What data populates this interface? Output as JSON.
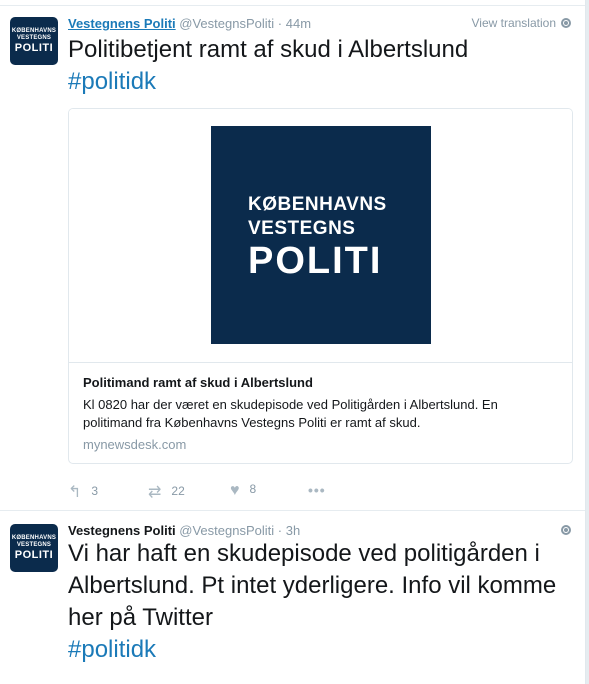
{
  "tweets": [
    {
      "avatar": {
        "line1": "KØBENHAVNS",
        "line2": "VESTEGNS",
        "line3": "POLITI"
      },
      "name": "Vestegnens Politi",
      "handle": "@VestegnsPoliti",
      "separator": "·",
      "time": "44m",
      "translate_label": "View translation",
      "text": "Politibetjent ramt af skud i Albertslund",
      "hashtag": "#politidk",
      "card": {
        "logo": {
          "line1": "KØBENHAVNS",
          "line2": "VESTEGNS",
          "line3": "POLITI"
        },
        "title": "Politimand ramt af skud i Albertslund",
        "description": "Kl 0820 har der været en skudepisode ved Politigården i Albertslund. En politimand fra Københavns Vestegns Politi er ramt af skud.",
        "domain": "mynewsdesk.com"
      },
      "actions": {
        "replies": "3",
        "retweets": "22",
        "likes": "8"
      }
    },
    {
      "avatar": {
        "line1": "KØBENHAVNS",
        "line2": "VESTEGNS",
        "line3": "POLITI"
      },
      "name": "Vestegnens Politi",
      "handle": "@VestegnsPoliti",
      "separator": "·",
      "time": "3h",
      "text": "Vi har haft en skudepisode ved politigården i Albertslund. Pt intet yderligere. Info vil komme her på Twitter",
      "hashtag": "#politidk"
    }
  ],
  "icons": {
    "reply": "reply-icon",
    "retweet": "retweet-icon",
    "like": "heart-icon",
    "more": "more-icon",
    "globe": "globe-icon"
  },
  "colors": {
    "link": "#1b7ab8",
    "brand_navy": "#0b2b4c",
    "muted": "#8899a6"
  }
}
